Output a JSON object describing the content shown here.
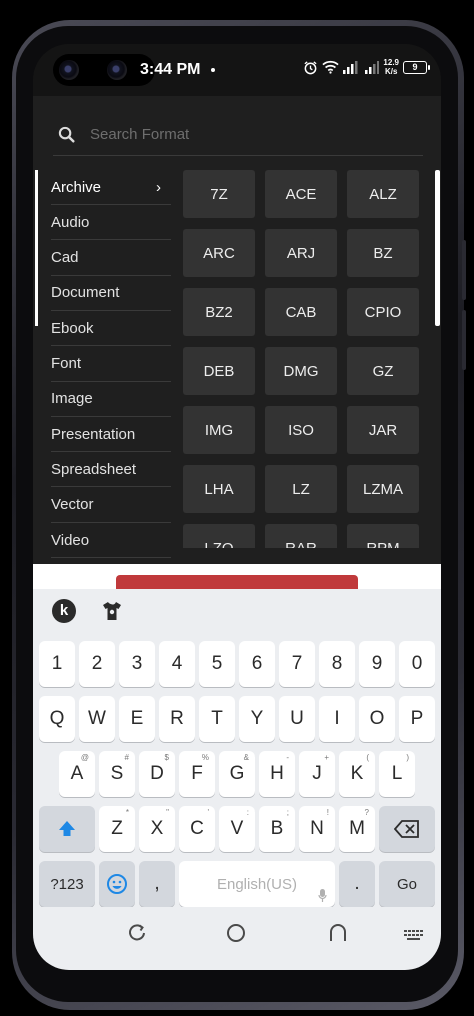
{
  "status_bar": {
    "time": "3:44 PM",
    "network_speed_value": "12.9",
    "network_speed_unit": "K/s",
    "battery_level": "9",
    "icons": [
      "alarm-icon",
      "wifi-icon",
      "signal-icon",
      "signal-icon-2",
      "battery-icon"
    ]
  },
  "search": {
    "placeholder": "Search Format"
  },
  "categories": [
    {
      "label": "Archive",
      "active": true
    },
    {
      "label": "Audio"
    },
    {
      "label": "Cad"
    },
    {
      "label": "Document"
    },
    {
      "label": "Ebook"
    },
    {
      "label": "Font"
    },
    {
      "label": "Image"
    },
    {
      "label": "Presentation"
    },
    {
      "label": "Spreadsheet"
    },
    {
      "label": "Vector"
    },
    {
      "label": "Video"
    }
  ],
  "active_category_chevron": "›",
  "formats": [
    "7Z",
    "ACE",
    "ALZ",
    "ARC",
    "ARJ",
    "BZ",
    "BZ2",
    "CAB",
    "CPIO",
    "DEB",
    "DMG",
    "GZ",
    "IMG",
    "ISO",
    "JAR",
    "LHA",
    "LZ",
    "LZMA",
    "LZO",
    "RAR",
    "RPM"
  ],
  "keyboard": {
    "brand_letter": "k",
    "number_row": [
      "1",
      "2",
      "3",
      "4",
      "5",
      "6",
      "7",
      "8",
      "9",
      "0"
    ],
    "row1": [
      "Q",
      "W",
      "E",
      "R",
      "T",
      "Y",
      "U",
      "I",
      "O",
      "P"
    ],
    "row2": [
      {
        "label": "A",
        "hint": "@"
      },
      {
        "label": "S",
        "hint": "#"
      },
      {
        "label": "D",
        "hint": "$"
      },
      {
        "label": "F",
        "hint": "%"
      },
      {
        "label": "G",
        "hint": "&"
      },
      {
        "label": "H",
        "hint": "-"
      },
      {
        "label": "J",
        "hint": "+"
      },
      {
        "label": "K",
        "hint": "("
      },
      {
        "label": "L",
        "hint": ")"
      }
    ],
    "row3": [
      {
        "label": "Z",
        "hint": "*"
      },
      {
        "label": "X",
        "hint": "\""
      },
      {
        "label": "C",
        "hint": "'"
      },
      {
        "label": "V",
        "hint": ":"
      },
      {
        "label": "B",
        "hint": ";"
      },
      {
        "label": "N",
        "hint": "!"
      },
      {
        "label": "M",
        "hint": "?"
      }
    ],
    "symbols_label": "?123",
    "comma": ",",
    "space_label": "English(US)",
    "period": ".",
    "go_label": "Go"
  },
  "colors": {
    "panel_bg": "#1f1f1f",
    "format_tile": "#333333",
    "accent_red": "#c0393b",
    "shift_blue": "#1e88e5"
  }
}
